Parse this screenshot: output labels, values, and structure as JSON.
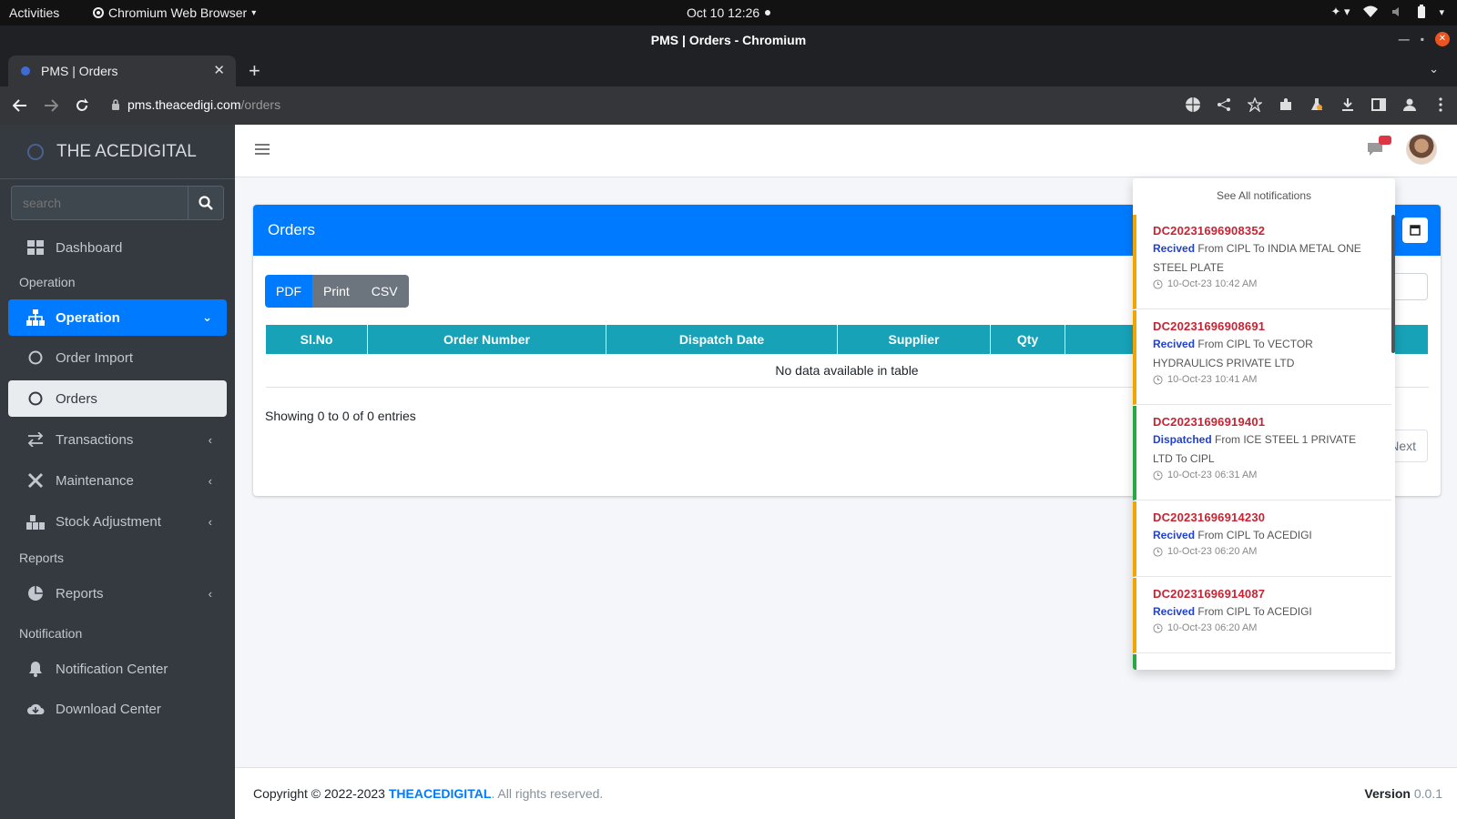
{
  "os": {
    "activities": "Activities",
    "app_name": "Chromium Web Browser",
    "clock": "Oct 10  12:26"
  },
  "browser": {
    "window_title": "PMS | Orders - Chromium",
    "tab_title": "PMS | Orders",
    "url_host": "pms.theacedigi.com",
    "url_path": "/orders"
  },
  "sidebar": {
    "brand": "THE ACEDIGITAL",
    "search_placeholder": "search",
    "dashboard": "Dashboard",
    "header_operation": "Operation",
    "operation": "Operation",
    "order_import": "Order Import",
    "orders": "Orders",
    "transactions": "Transactions",
    "maintenance": "Maintenance",
    "stock_adjustment": "Stock Adjustment",
    "header_reports": "Reports",
    "reports": "Reports",
    "header_notification": "Notification",
    "notification_center": "Notification Center",
    "download_center": "Download Center"
  },
  "card": {
    "title": "Orders",
    "btn_pdf": "PDF",
    "btn_print": "Print",
    "btn_csv": "CSV",
    "columns": [
      "Sl.No",
      "Order Number",
      "Dispatch Date",
      "Supplier",
      "Qty"
    ],
    "empty": "No data available in table",
    "info": "Showing 0 to 0 of 0 entries",
    "next": "Next"
  },
  "notifications": {
    "see_all": "See All notifications",
    "items": [
      {
        "code": "DC20231696908352",
        "status": "Recived",
        "text": " From CIPL To INDIA METAL ONE STEEL PLATE",
        "time": "10-Oct-23 10:42 AM"
      },
      {
        "code": "DC20231696908691",
        "status": "Recived",
        "text": " From CIPL To VECTOR HYDRAULICS PRIVATE LTD",
        "time": "10-Oct-23 10:41 AM"
      },
      {
        "code": "DC20231696919401",
        "status": "Dispatched",
        "text": " From ICE STEEL 1 PRIVATE LTD To CIPL",
        "time": "10-Oct-23 06:31 AM"
      },
      {
        "code": "DC20231696914230",
        "status": "Recived",
        "text": " From CIPL To ACEDIGI",
        "time": "10-Oct-23 06:20 AM"
      },
      {
        "code": "DC20231696914087",
        "status": "Recived",
        "text": " From CIPL To ACEDIGI",
        "time": "10-Oct-23 06:20 AM"
      }
    ]
  },
  "footer": {
    "copyright": "Copyright © 2022-2023 ",
    "brand": "THEACEDIGITAL",
    "rights": ". All rights reserved.",
    "version_label": "Version",
    "version": " 0.0.1"
  },
  "colors": {
    "primary": "#007bff",
    "info": "#17a2b8",
    "sidebar": "#343a40",
    "notif_code": "#c82333",
    "received_border": "#f0a500",
    "dispatched_border": "#28a745"
  }
}
